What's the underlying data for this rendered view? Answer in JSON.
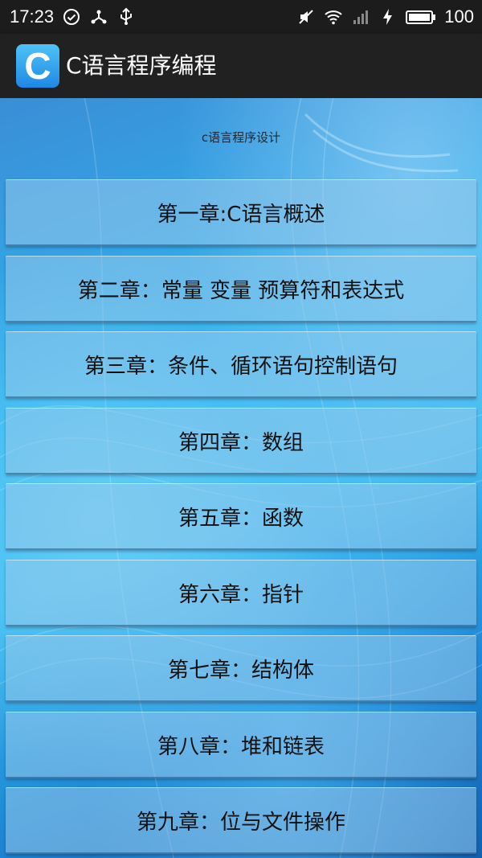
{
  "status_bar": {
    "time": "17:23",
    "battery": "100",
    "left_icons": [
      "check-circle-icon",
      "usb-tethering-icon",
      "usb-icon"
    ],
    "right_icons": [
      "mute-icon",
      "wifi-icon",
      "no-signal-icon",
      "charging-icon",
      "battery-icon"
    ]
  },
  "app_bar": {
    "logo_letter": "C",
    "title": "C语言程序编程"
  },
  "main": {
    "subtitle": "c语言程序设计",
    "chapters": [
      {
        "label": "第一章:C语言概述"
      },
      {
        "label": "第二章：常量 变量 预算符和表达式"
      },
      {
        "label": "第三章：条件、循环语句控制语句"
      },
      {
        "label": "第四章：数组"
      },
      {
        "label": "第五章：函数"
      },
      {
        "label": "第六章：指针"
      },
      {
        "label": "第七章：结构体"
      },
      {
        "label": "第八章：堆和链表"
      },
      {
        "label": "第九章：位与文件操作"
      }
    ]
  },
  "colors": {
    "status_bar_bg": "#1c1c1c",
    "app_bar_bg": "#212121",
    "logo_gradient_top": "#4fc3f7",
    "logo_gradient_bottom": "#1e88e5",
    "content_bg": "#2fb3ef"
  }
}
